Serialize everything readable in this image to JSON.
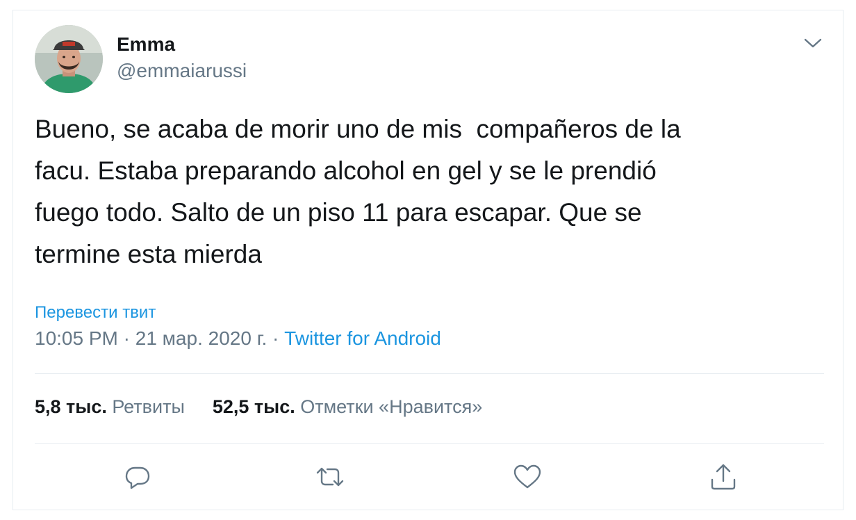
{
  "tweet": {
    "author_name": "Emma",
    "author_handle": "@emmaiarussi",
    "text": "Bueno, se acaba de morir uno de mis  compañeros de la\nfacu. Estaba preparando alcohol en gel y se le prendió\nfuego todo. Salto de un piso 11 para escapar. Que se\ntermine esta mierda",
    "translate_label": "Перевести твит",
    "time": "10:05 PM",
    "separator": " · ",
    "date": "21 мар. 2020 г.",
    "source": "Twitter for Android"
  },
  "stats": {
    "retweets_count": "5,8 тыс.",
    "retweets_label": "Ретвиты",
    "likes_count": "52,5 тыс.",
    "likes_label": "Отметки «Нравится»"
  },
  "icons": {
    "more": "chevron-down-icon",
    "reply": "reply-icon",
    "retweet": "retweet-icon",
    "like": "heart-icon",
    "share": "share-icon"
  },
  "colors": {
    "text": "#14171a",
    "secondary": "#657786",
    "link": "#1b95e0",
    "divider": "#e6ecf0"
  }
}
